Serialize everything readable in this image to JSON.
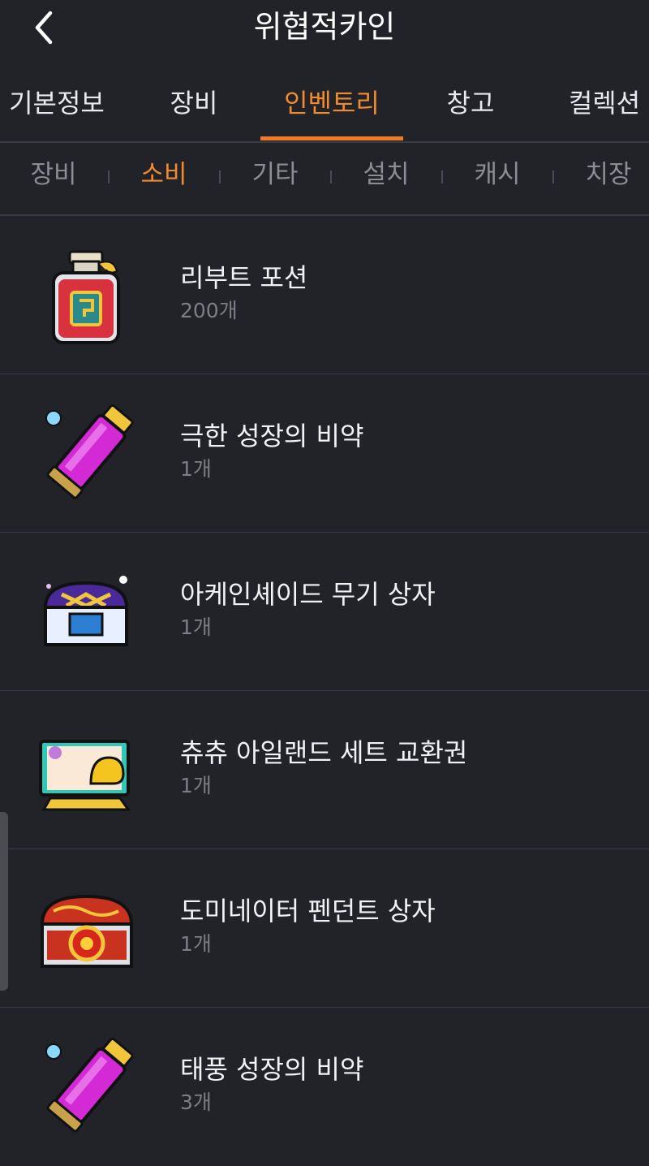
{
  "header": {
    "title": "위협적카인",
    "back_icon": "chevron-left-icon"
  },
  "tabs": [
    {
      "label": "기본정보",
      "active": false
    },
    {
      "label": "장비",
      "active": false
    },
    {
      "label": "인벤토리",
      "active": true
    },
    {
      "label": "창고",
      "active": false
    },
    {
      "label": "컬렉션",
      "active": false
    }
  ],
  "subtabs": [
    {
      "label": "장비",
      "active": false
    },
    {
      "label": "소비",
      "active": true
    },
    {
      "label": "기타",
      "active": false
    },
    {
      "label": "설치",
      "active": false
    },
    {
      "label": "캐시",
      "active": false
    },
    {
      "label": "치장",
      "active": false
    }
  ],
  "items": [
    {
      "name": "리부트 포션",
      "count": "200개",
      "icon": "potion-bottle-icon"
    },
    {
      "name": "극한 성장의 비약",
      "count": "1개",
      "icon": "purple-elixir-tube-icon"
    },
    {
      "name": "아케인셰이드 무기 상자",
      "count": "1개",
      "icon": "purple-treasure-chest-icon"
    },
    {
      "name": "츄츄 아일랜드 세트 교환권",
      "count": "1개",
      "icon": "exchange-ticket-icon"
    },
    {
      "name": "도미네이터 펜던트 상자",
      "count": "1개",
      "icon": "red-treasure-chest-icon"
    },
    {
      "name": "태풍 성장의 비약",
      "count": "3개",
      "icon": "purple-elixir-tube-icon"
    }
  ],
  "colors": {
    "background": "#212329",
    "accent": "#f28a2f",
    "divider": "#393b42",
    "muted_text": "#7d7f85"
  }
}
